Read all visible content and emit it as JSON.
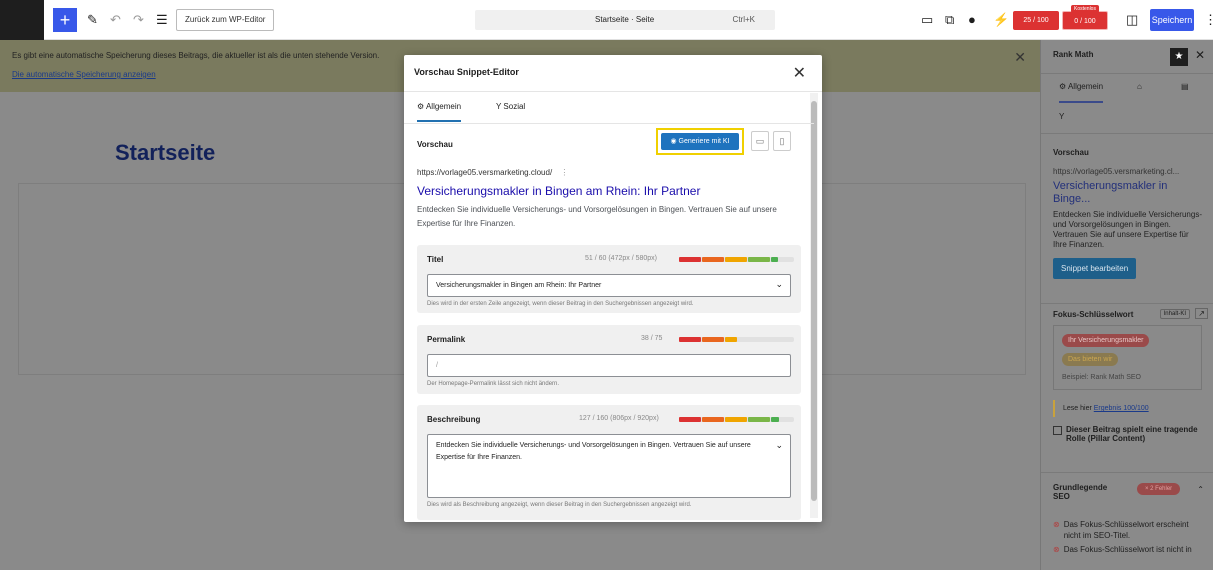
{
  "topbar": {
    "back_label": "Zurück zum WP-Editor",
    "command_title": "Startseite · Seite",
    "command_shortcut": "Ctrl+K",
    "seo_score": "25 / 100",
    "ki_score": "0 / 100",
    "ki_tag": "Kostenlos",
    "save_label": "Speichern"
  },
  "notice": {
    "text": "Es gibt eine automatische Speicherung dieses Beitrags, die aktueller ist als die unten stehende Version.",
    "link": "Die automatische Speicherung anzeigen"
  },
  "editor": {
    "page_title": "Startseite"
  },
  "modal": {
    "title": "Vorschau Snippet-Editor",
    "tab_general": "Allgemein",
    "tab_social": "Sozial",
    "preview_label": "Vorschau",
    "ai_button": "Generiere mit KI",
    "preview": {
      "url": "https://vorlage05.versmarketing.cloud/",
      "title": "Versicherungsmakler in Bingen am Rhein: Ihr Partner",
      "description": "Entdecken Sie individuelle Versicherungs- und Vorsorgelösungen in Bingen. Vertrauen Sie auf unsere Expertise für Ihre Finanzen."
    },
    "title_field": {
      "label": "Titel",
      "count": "51 / 60 (472px / 580px)",
      "value": "Versicherungsmakler in Bingen am Rhein: Ihr Partner",
      "help": "Dies wird in der ersten Zeile angezeigt, wenn dieser Beitrag in den Suchergebnissen angezeigt wird."
    },
    "permalink_field": {
      "label": "Permalink",
      "count": "38 / 75",
      "value": "/",
      "help": "Der Homepage-Permalink lässt sich nicht ändern."
    },
    "description_field": {
      "label": "Beschreibung",
      "count": "127 / 160 (806px / 920px)",
      "value": "Entdecken Sie individuelle Versicherungs- und Vorsorgelösungen in Bingen. Vertrauen Sie auf unsere Expertise für Ihre Finanzen.",
      "help": "Dies wird als Beschreibung angezeigt, wenn dieser Beitrag in den Suchergebnissen angezeigt wird."
    }
  },
  "sidebar": {
    "title": "Rank Math",
    "tab_general": "Allgemein",
    "preview_label": "Vorschau",
    "preview_url": "https://vorlage05.versmarketing.cl...",
    "preview_title": "Versicherungsmakler in Binge...",
    "preview_desc": "Entdecken Sie individuelle Versicherungs- und Vorsorgelösungen in Bingen. Vertrauen Sie auf unsere Expertise für Ihre Finanzen.",
    "edit_snippet": "Snippet bearbeiten",
    "focus_kw_label": "Fokus-Schlüsselwort",
    "content_ki": "Inhalt-KI",
    "keyword1": "Ihr Versicherungsmakler",
    "keyword2": "Das bieten wir",
    "kw_placeholder": "Beispiel: Rank Math SEO",
    "result_text": "Lese hier",
    "result_link": "Ergebnis 100/100",
    "pillar_label": "Dieser Beitrag spielt eine tragende Rolle (Pillar Content)",
    "basic_seo": "Grundlegende SEO",
    "errors_badge": "× 2 Fehler",
    "check1": "Das Fokus-Schlüsselwort erscheint nicht im SEO-Titel.",
    "check2": "Das Fokus-Schlüsselwort ist nicht in"
  },
  "colors": {
    "accent": "#3858e9",
    "ai_button": "#1e73be",
    "error": "#dc3232",
    "highlight": "#f0d000"
  }
}
